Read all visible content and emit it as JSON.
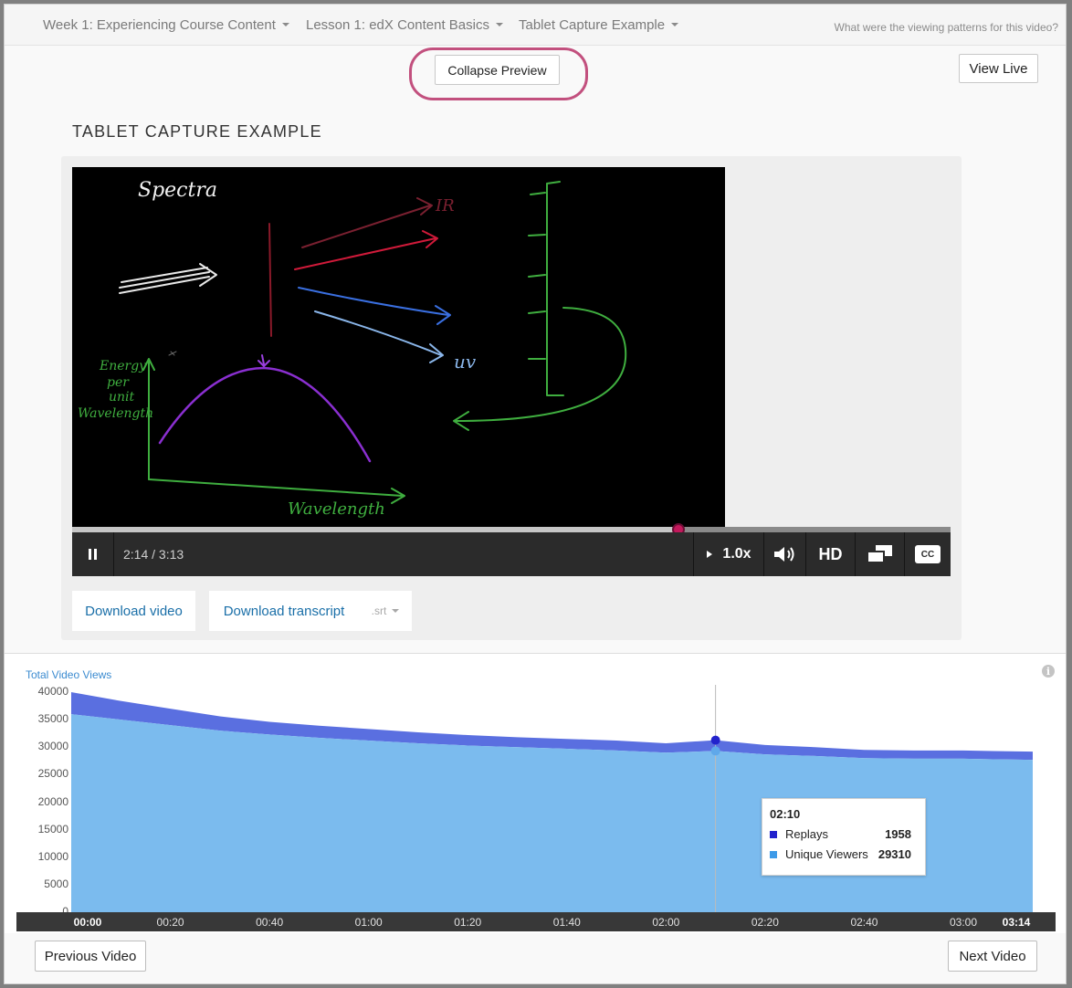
{
  "breadcrumbs": [
    {
      "label": "Week 1: Experiencing Course Content"
    },
    {
      "label": "Lesson 1: edX Content Basics"
    },
    {
      "label": "Tablet Capture Example"
    }
  ],
  "header": {
    "question": "What were the viewing patterns for this video?"
  },
  "toolbar": {
    "collapse_label": "Collapse Preview",
    "view_live_label": "View Live"
  },
  "video": {
    "title": "TABLET CAPTURE EXAMPLE",
    "drawing_labels": {
      "spectra": "Spectra",
      "ir": "IR",
      "uv": "uv",
      "energy": [
        "Energy",
        "per",
        "unit",
        "Wavelength"
      ],
      "wavelength": "Wavelength"
    },
    "time_display": "2:14 / 3:13",
    "progress_fraction": 0.69,
    "speed_label": "1.0x",
    "hd_label": "HD",
    "cc_label": "CC"
  },
  "downloads": {
    "video_label": "Download video",
    "transcript_label": "Download transcript",
    "format_label": ".srt"
  },
  "chart_data": {
    "type": "area",
    "title": "Total Video Views",
    "ylim": [
      0,
      40000
    ],
    "y_ticks": [
      "40000",
      "35000",
      "30000",
      "25000",
      "20000",
      "15000",
      "10000",
      "5000",
      "0"
    ],
    "x_tick_labels": [
      "00:00",
      "00:20",
      "00:40",
      "01:00",
      "01:20",
      "01:40",
      "02:00",
      "02:20",
      "02:40",
      "03:00",
      "03:14"
    ],
    "x_tick_seconds": [
      0,
      20,
      40,
      60,
      80,
      100,
      120,
      140,
      160,
      180,
      194
    ],
    "x_max": 194,
    "stacked": true,
    "grid": false,
    "legend": "tooltip",
    "series": [
      {
        "name": "Unique Viewers",
        "color": "#7bbbee",
        "x": [
          0,
          10,
          20,
          30,
          40,
          50,
          60,
          70,
          80,
          90,
          100,
          110,
          120,
          130,
          140,
          150,
          160,
          170,
          180,
          186,
          194
        ],
        "values": [
          36000,
          35000,
          34000,
          33000,
          32300,
          31700,
          31200,
          30700,
          30300,
          30000,
          29700,
          29400,
          29000,
          29310,
          28700,
          28400,
          28000,
          27900,
          27900,
          27800,
          27700
        ]
      },
      {
        "name": "Replays",
        "color": "#5a6fe0",
        "x": [
          0,
          10,
          20,
          30,
          40,
          50,
          60,
          70,
          80,
          90,
          100,
          110,
          120,
          130,
          140,
          150,
          160,
          170,
          180,
          186,
          194
        ],
        "values": [
          4000,
          3400,
          3000,
          2600,
          2300,
          2200,
          2100,
          2000,
          1900,
          1800,
          1800,
          1800,
          1700,
          1958,
          1700,
          1600,
          1500,
          1500,
          1500,
          1500,
          1500
        ]
      }
    ],
    "hover": {
      "x": 130,
      "label": "02:10",
      "rows": [
        {
          "name": "Replays",
          "value": "1958",
          "color": "#2222cc"
        },
        {
          "name": "Unique Viewers",
          "value": "29310",
          "color": "#3d9ae8"
        }
      ]
    }
  },
  "footer": {
    "prev_label": "Previous Video",
    "next_label": "Next Video"
  }
}
